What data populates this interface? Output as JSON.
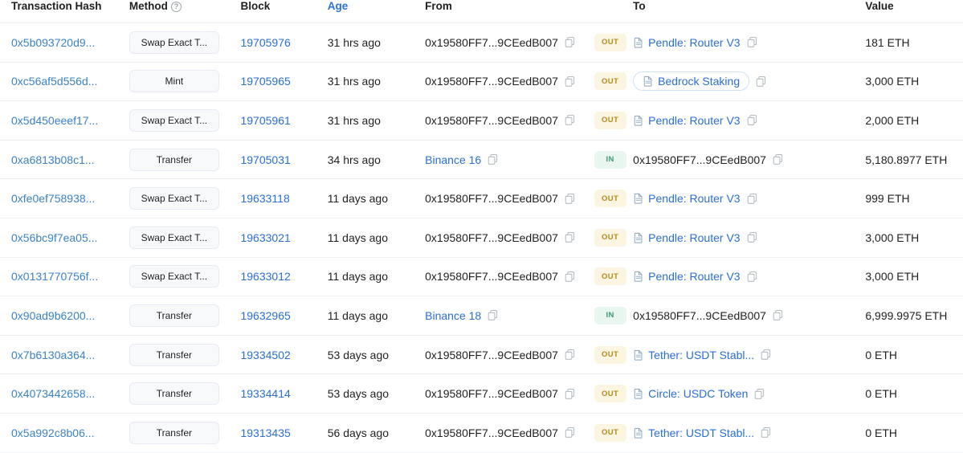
{
  "table": {
    "columns": [
      {
        "key": "hash",
        "label": "Transaction Hash",
        "link": false,
        "help": false
      },
      {
        "key": "method",
        "label": "Method",
        "link": false,
        "help": true
      },
      {
        "key": "block",
        "label": "Block",
        "link": false,
        "help": false
      },
      {
        "key": "age",
        "label": "Age",
        "link": true,
        "help": false
      },
      {
        "key": "from",
        "label": "From",
        "link": false,
        "help": false
      },
      {
        "key": "to",
        "label": "To",
        "link": false,
        "help": false
      },
      {
        "key": "value",
        "label": "Value",
        "link": false,
        "help": false
      }
    ],
    "help_glyph": "?",
    "copy_icon": "copy-icon",
    "doc_icon": "contract-document-icon",
    "rows": [
      {
        "hash": "0x5b093720d9...",
        "method": "Swap Exact T...",
        "block": "19705976",
        "age": "31 hrs ago",
        "from": "0x19580FF7...9CEedB007",
        "from_is_link": false,
        "direction": "OUT",
        "to": "Pendle: Router V3",
        "to_is_link": true,
        "to_has_doc_icon": true,
        "to_is_pill": false,
        "value": "181 ETH"
      },
      {
        "hash": "0xc56af5d556d...",
        "method": "Mint",
        "block": "19705965",
        "age": "31 hrs ago",
        "from": "0x19580FF7...9CEedB007",
        "from_is_link": false,
        "direction": "OUT",
        "to": "Bedrock Staking",
        "to_is_link": true,
        "to_has_doc_icon": true,
        "to_is_pill": true,
        "value": "3,000 ETH"
      },
      {
        "hash": "0x5d450eeef17...",
        "method": "Swap Exact T...",
        "block": "19705961",
        "age": "31 hrs ago",
        "from": "0x19580FF7...9CEedB007",
        "from_is_link": false,
        "direction": "OUT",
        "to": "Pendle: Router V3",
        "to_is_link": true,
        "to_has_doc_icon": true,
        "to_is_pill": false,
        "value": "2,000 ETH"
      },
      {
        "hash": "0xa6813b08c1...",
        "method": "Transfer",
        "block": "19705031",
        "age": "34 hrs ago",
        "from": "Binance 16",
        "from_is_link": true,
        "direction": "IN",
        "to": "0x19580FF7...9CEedB007",
        "to_is_link": false,
        "to_has_doc_icon": false,
        "to_is_pill": false,
        "value": "5,180.8977 ETH"
      },
      {
        "hash": "0xfe0ef758938...",
        "method": "Swap Exact T...",
        "block": "19633118",
        "age": "11 days ago",
        "from": "0x19580FF7...9CEedB007",
        "from_is_link": false,
        "direction": "OUT",
        "to": "Pendle: Router V3",
        "to_is_link": true,
        "to_has_doc_icon": true,
        "to_is_pill": false,
        "value": "999 ETH"
      },
      {
        "hash": "0x56bc9f7ea05...",
        "method": "Swap Exact T...",
        "block": "19633021",
        "age": "11 days ago",
        "from": "0x19580FF7...9CEedB007",
        "from_is_link": false,
        "direction": "OUT",
        "to": "Pendle: Router V3",
        "to_is_link": true,
        "to_has_doc_icon": true,
        "to_is_pill": false,
        "value": "3,000 ETH"
      },
      {
        "hash": "0x0131770756f...",
        "method": "Swap Exact T...",
        "block": "19633012",
        "age": "11 days ago",
        "from": "0x19580FF7...9CEedB007",
        "from_is_link": false,
        "direction": "OUT",
        "to": "Pendle: Router V3",
        "to_is_link": true,
        "to_has_doc_icon": true,
        "to_is_pill": false,
        "value": "3,000 ETH"
      },
      {
        "hash": "0x90ad9b6200...",
        "method": "Transfer",
        "block": "19632965",
        "age": "11 days ago",
        "from": "Binance 18",
        "from_is_link": true,
        "direction": "IN",
        "to": "0x19580FF7...9CEedB007",
        "to_is_link": false,
        "to_has_doc_icon": false,
        "to_is_pill": false,
        "value": "6,999.9975 ETH"
      },
      {
        "hash": "0x7b6130a364...",
        "method": "Transfer",
        "block": "19334502",
        "age": "53 days ago",
        "from": "0x19580FF7...9CEedB007",
        "from_is_link": false,
        "direction": "OUT",
        "to": "Tether: USDT Stabl...",
        "to_is_link": true,
        "to_has_doc_icon": true,
        "to_is_pill": false,
        "value": "0 ETH"
      },
      {
        "hash": "0x4073442658...",
        "method": "Transfer",
        "block": "19334414",
        "age": "53 days ago",
        "from": "0x19580FF7...9CEedB007",
        "from_is_link": false,
        "direction": "OUT",
        "to": "Circle: USDC Token",
        "to_is_link": true,
        "to_has_doc_icon": true,
        "to_is_pill": false,
        "value": "0 ETH"
      },
      {
        "hash": "0x5a992c8b06...",
        "method": "Transfer",
        "block": "19313435",
        "age": "56 days ago",
        "from": "0x19580FF7...9CEedB007",
        "from_is_link": false,
        "direction": "OUT",
        "to": "Tether: USDT Stabl...",
        "to_is_link": true,
        "to_has_doc_icon": true,
        "to_is_pill": false,
        "value": "0 ETH"
      }
    ]
  },
  "colors": {
    "link": "#2a6ed8",
    "hash_link": "#3b82c4",
    "out_badge_bg": "#fcf5e2",
    "out_badge_text": "#b58a1b",
    "in_badge_bg": "#e8f6ef",
    "in_badge_text": "#3e9a74",
    "row_border": "#eef0f2",
    "method_bg": "#f8f9fa",
    "text": "#1e2022"
  }
}
